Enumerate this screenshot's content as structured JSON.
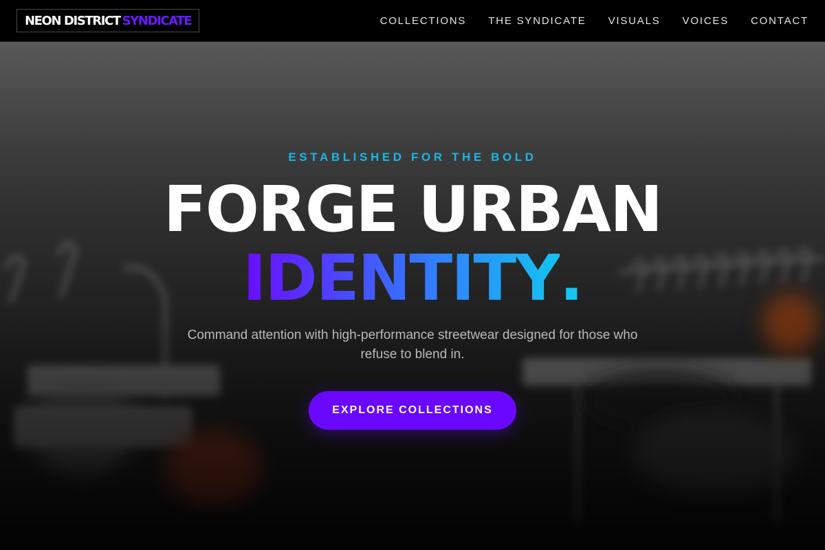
{
  "brand": {
    "name_part1": "NEON DISTRICT",
    "name_part2": "SYNDICATE"
  },
  "nav": {
    "items": [
      {
        "label": "COLLECTIONS"
      },
      {
        "label": "THE SYNDICATE"
      },
      {
        "label": "VISUALS"
      },
      {
        "label": "VOICES"
      },
      {
        "label": "CONTACT"
      }
    ]
  },
  "hero": {
    "eyebrow": "ESTABLISHED FOR THE BOLD",
    "headline_line1": "FORGE URBAN",
    "headline_line2": "IDENTITY",
    "headline_dot": ".",
    "subtitle": "Command attention with high-performance streetwear designed for those who refuse to blend in.",
    "cta_label": "EXPLORE COLLECTIONS"
  },
  "colors": {
    "accent_purple": "#6a08ff",
    "accent_cyan": "#14c4f2",
    "background": "#000000"
  }
}
